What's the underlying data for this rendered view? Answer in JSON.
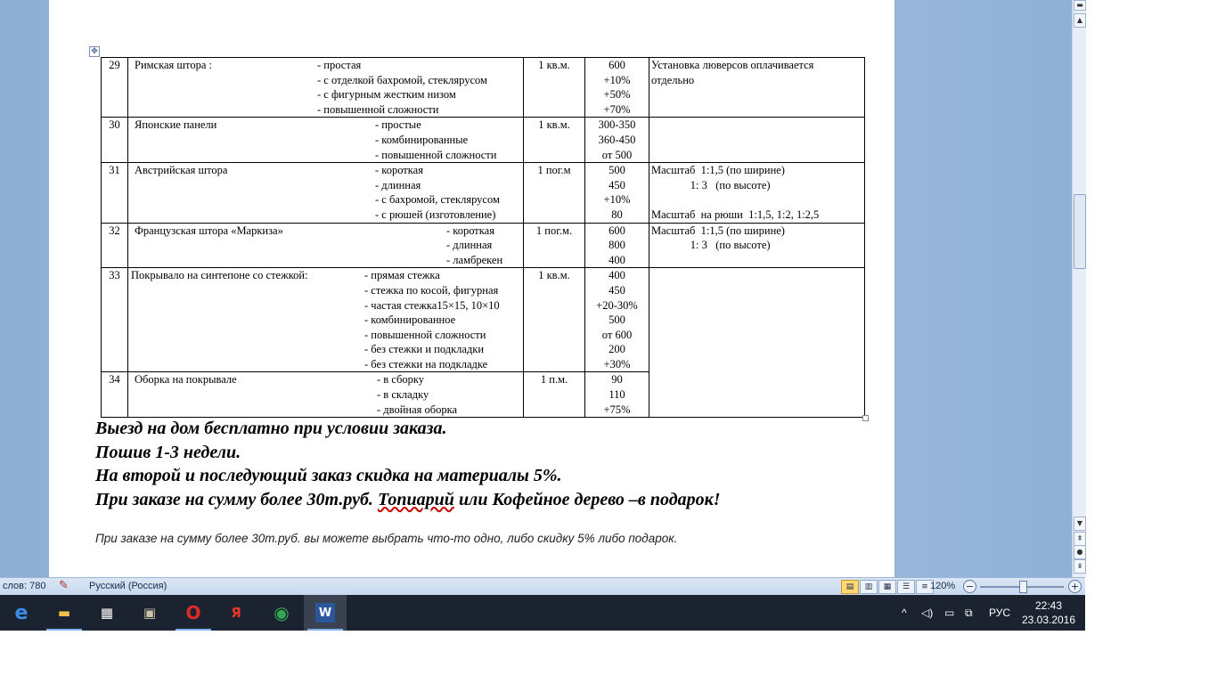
{
  "document": {
    "rows": [
      {
        "num": "29",
        "name": "Римская штора :",
        "name_wavy": ":",
        "options": [
          "- простая",
          "- с отделкой бахромой, стеклярусом",
          "- с  фигурным жестким низом",
          "- повышенной сложности"
        ],
        "unit": "1 кв.м.",
        "prices": [
          "600",
          "+10%",
          "+50%",
          "+70%"
        ],
        "note": [
          "Установка люверсов оплачивается",
          "отдельно"
        ]
      },
      {
        "num": "30",
        "name": "Японские панели",
        "options": [
          "- простые",
          "- комбинированные",
          "- повышенной сложности"
        ],
        "unit": "1 кв.м.",
        "prices": [
          "300-350",
          "360-450",
          "от 500"
        ],
        "note": []
      },
      {
        "num": "31",
        "name": "Австрийская штора",
        "options": [
          "- короткая",
          "- длинная",
          "- с бахромой,  стеклярусом",
          "- с рюшей (изготовление)"
        ],
        "unit": "1 пог.м",
        "prices": [
          "500",
          "450",
          "+10%",
          "80"
        ],
        "note": [
          "Масштаб  1:1,5 (по ширине)",
          "              1: 3   (по высоте)",
          "",
          "Масштаб  на рюши  1:1,5, 1:2, 1:2,5"
        ]
      },
      {
        "num": "32",
        "name": "Французская штора «Маркиза»",
        "options": [
          "- короткая",
          "- длинная",
          "- ламбрекен"
        ],
        "unit": "1 пог.м.",
        "prices": [
          "600",
          "800",
          "400"
        ],
        "note": [
          "Масштаб  1:1,5 (по ширине)",
          "              1: 3   (по высоте)"
        ]
      },
      {
        "num": "33",
        "name": "Покрывало на синтепоне со стежкой:",
        "options": [
          "- прямая стежка",
          "- стежка по косой, фигурная",
          "- частая  стежка15×15,  10×10",
          "- комбинированное",
          "-  повышенной сложности",
          "- без стежки и подкладки",
          "- без стежки  на подкладке"
        ],
        "unit": "1 кв.м.",
        "prices": [
          "400",
          "450",
          "+20-30%",
          "500",
          "от 600",
          "200",
          "+30%"
        ],
        "note": []
      },
      {
        "num": "34",
        "name": "Оборка на покрывале",
        "options": [
          "- в сборку",
          "- в складку",
          "- двойная оборка"
        ],
        "unit": "1 п.м.",
        "prices": [
          "90",
          "110",
          "+75%"
        ],
        "note": []
      }
    ],
    "bold_lines": [
      "Выезд на дом бесплатно при условии заказа.",
      "Пошив 1-3 недели.",
      "На второй и последующий  заказ скидка на материалы  5%.",
      "При заказе на сумму  более 30т.руб. Топиарий или Кофейное  дерево –в подарок!"
    ],
    "footnote": "При заказе на сумму более 30т.руб. вы можете выбрать что-то одно, либо скидку 5% либо подарок."
  },
  "statusbar": {
    "words": "слов: 780",
    "language": "Русский (Россия)",
    "zoom": "120%",
    "zoom_minus": "−",
    "zoom_plus": "+"
  },
  "taskbar": {
    "items": [
      {
        "name": "edge-icon",
        "glyph": "e",
        "color": "#3b8ee6"
      },
      {
        "name": "file-explorer-icon",
        "glyph": "▬",
        "color": "#f0c24a"
      },
      {
        "name": "store-icon",
        "glyph": "▦",
        "color": "#ffffff"
      },
      {
        "name": "app-icon",
        "glyph": "▣",
        "color": "#c9c2a8"
      },
      {
        "name": "opera-icon",
        "glyph": "O",
        "color": "#e02a2a"
      },
      {
        "name": "yandex-icon",
        "glyph": "Я",
        "color": "#e8372c"
      },
      {
        "name": "chrome-icon",
        "glyph": "◉",
        "color": "#36a852"
      },
      {
        "name": "word-icon",
        "glyph": "W",
        "color": "#2b579a"
      }
    ],
    "tray": {
      "chevron": "^",
      "volume": "🔊",
      "battery": "▭",
      "network": "⚿",
      "lang": "РУС"
    },
    "time": "22:43",
    "date": "23.03.2016"
  }
}
